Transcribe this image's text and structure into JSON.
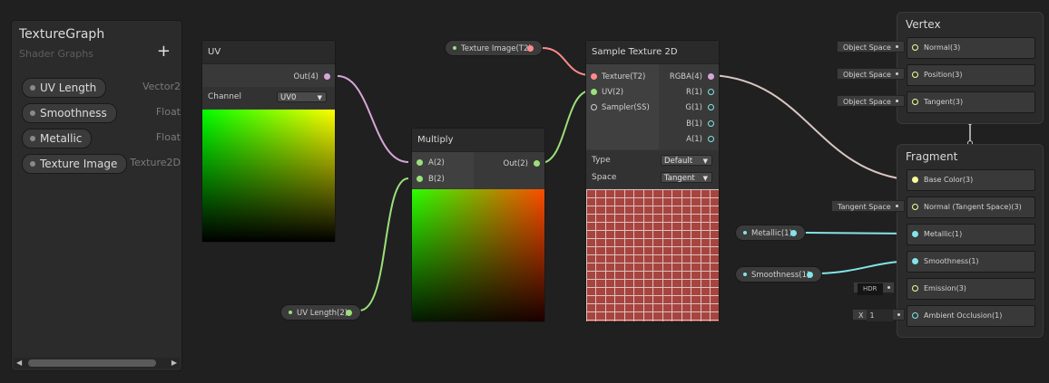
{
  "blackboard": {
    "title": "TextureGraph",
    "subtitle": "Shader Graphs",
    "add_icon": "plus",
    "properties": [
      {
        "name": "UV Length",
        "type": "Vector2"
      },
      {
        "name": "Smoothness",
        "type": "Float"
      },
      {
        "name": "Metallic",
        "type": "Float"
      },
      {
        "name": "Texture Image",
        "type": "Texture2D"
      }
    ],
    "scroll_left": "◀",
    "scroll_right": "▶"
  },
  "uv_node": {
    "title": "UV",
    "output": "Out(4)",
    "channel_label": "Channel",
    "channel_value": "UV0"
  },
  "multiply_node": {
    "title": "Multiply",
    "inputs": [
      "A(2)",
      "B(2)"
    ],
    "output": "Out(2)"
  },
  "sample_node": {
    "title": "Sample Texture 2D",
    "inputs": [
      "Texture(T2)",
      "UV(2)",
      "Sampler(SS)"
    ],
    "outputs": [
      "RGBA(4)",
      "R(1)",
      "G(1)",
      "B(1)",
      "A(1)"
    ],
    "type_label": "Type",
    "type_value": "Default",
    "space_label": "Space",
    "space_value": "Tangent"
  },
  "property_nodes": {
    "texture_image": "Texture Image(T2)",
    "uv_length": "UV Length(2)",
    "metallic": "Metallic(1)",
    "smoothness": "Smoothness(1)"
  },
  "vertex": {
    "title": "Vertex",
    "blocks": [
      {
        "label": "Normal(3)",
        "input": "Object Space"
      },
      {
        "label": "Position(3)",
        "input": "Object Space"
      },
      {
        "label": "Tangent(3)",
        "input": "Object Space"
      }
    ]
  },
  "fragment": {
    "title": "Fragment",
    "blocks": [
      {
        "label": "Base Color(3)"
      },
      {
        "label": "Normal (Tangent Space)(3)",
        "input": "Tangent Space"
      },
      {
        "label": "Metallic(1)"
      },
      {
        "label": "Smoothness(1)"
      },
      {
        "label": "Emission(3)",
        "input": "HDR"
      },
      {
        "label": "Ambient Occlusion(1)",
        "input_prefix": "X",
        "input_value": "1"
      }
    ]
  },
  "colors": {
    "vector4": "#d7a6d6",
    "vector2": "#9be07a",
    "vector1": "#84e4e7",
    "vector3": "#f6ff9a",
    "texture": "#ff8b8b",
    "background": "#202020"
  }
}
